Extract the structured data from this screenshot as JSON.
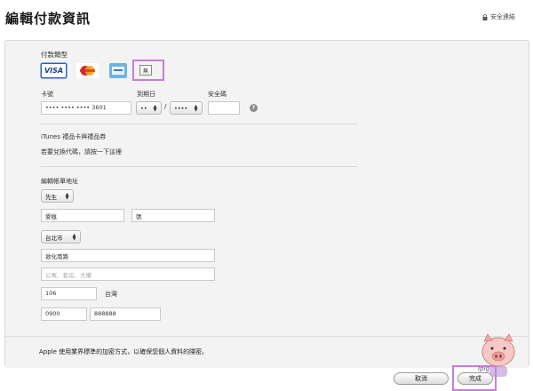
{
  "header": {
    "title": "編輯付款資訊",
    "secure_text": "安全連結"
  },
  "payment": {
    "type_label": "付款類型",
    "cards": [
      "VISA",
      "MasterCard",
      "AMEX"
    ],
    "none_label": "無",
    "card_number_label": "卡號",
    "card_number_value": "•••• •••• •••• 3601",
    "expiry_label": "到期日",
    "expiry_month": "••",
    "expiry_separator": "/",
    "expiry_year": "••••",
    "cvv_label": "安全碼",
    "help_symbol": "?"
  },
  "itunes": {
    "title": "iTunes 禮品卡與禮品券",
    "redeem_text": "若要兌換代碼，請按一下這裡"
  },
  "billing": {
    "title": "編輯帳單地址",
    "salutation": "先生",
    "first_name": "愛瘋",
    "last_name": "張",
    "city": "台北市",
    "street": "敦化南路",
    "street2_placeholder": "公寓、套房、大樓",
    "postal_code": "106",
    "country": "台灣",
    "phone_area": "0900",
    "phone_number": "888888"
  },
  "footer": {
    "encryption_text": "Apple 使用業界標準的加密方式，以確保您個人資料的隱密。"
  },
  "actions": {
    "cancel_label": "取消",
    "done_label": "完成"
  },
  "watermark": {
    "text": "Ipig"
  },
  "colors": {
    "highlight": "#c77dd8",
    "panel_bg": "#f3f3f3"
  }
}
